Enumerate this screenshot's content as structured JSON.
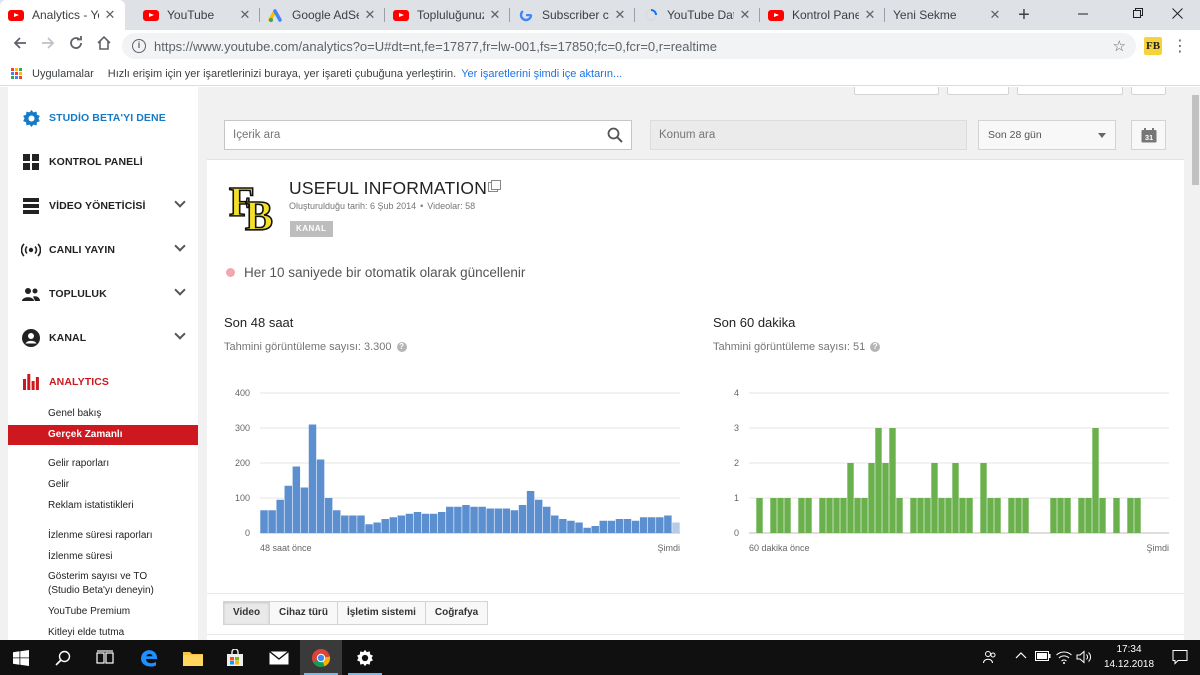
{
  "browser": {
    "tabs": [
      {
        "title": "Analytics - You",
        "favicon": "youtube-icon",
        "active": true
      },
      {
        "title": "YouTube",
        "favicon": "youtube-icon",
        "active": false
      },
      {
        "title": "Google AdSens",
        "favicon": "adsense-icon",
        "active": false
      },
      {
        "title": "Topluluğunuzu",
        "favicon": "youtube-icon",
        "active": false
      },
      {
        "title": "Subscriber cou",
        "favicon": "google-icon",
        "active": false
      },
      {
        "title": "YouTube Data",
        "favicon": "loading-icon",
        "active": false
      },
      {
        "title": "Kontrol Paneli",
        "favicon": "youtube-icon",
        "active": false
      },
      {
        "title": "Yeni Sekme",
        "favicon": "none",
        "active": false
      }
    ],
    "new_tab_symbol": "+",
    "url": "https://www.youtube.com/analytics?o=U#dt=nt,fe=17877,fr=lw-001,fs=17850;fc=0,fcr=0,r=realtime",
    "extension_label": "FB"
  },
  "bookmarks": {
    "apps_label": "Uygulamalar",
    "hint": "Hızlı erişim için yer işaretlerinizi buraya, yer işareti çubuğuna yerleştirin.",
    "import_link": "Yer işaretlerini şimdi içe aktarın..."
  },
  "sidebar": {
    "items": [
      {
        "label": "STUDİO BETA'YI DENE",
        "icon": "gear-icon"
      },
      {
        "label": "KONTROL PANELİ",
        "icon": "dashboard-icon"
      },
      {
        "label": "VİDEO YÖNETİCİSİ",
        "icon": "video-manager-icon"
      },
      {
        "label": "CANLI YAYIN",
        "icon": "live-broadcast-icon"
      },
      {
        "label": "TOPLULUK",
        "icon": "community-icon"
      },
      {
        "label": "KANAL",
        "icon": "channel-icon"
      },
      {
        "label": "ANALYTICS",
        "icon": "analytics-icon"
      }
    ],
    "sub_items": [
      {
        "label": "Genel bakış"
      },
      {
        "label": "Gerçek Zamanlı"
      },
      {
        "label": "Gelir raporları"
      },
      {
        "label": "Gelir"
      },
      {
        "label": "Reklam istatistikleri"
      },
      {
        "label": "İzlenme süresi raporları"
      },
      {
        "label": "İzlenme süresi"
      },
      {
        "label": "Gösterim sayısı ve TO"
      },
      {
        "label": "(Studio Beta'yı deneyin)"
      },
      {
        "label": "YouTube Premium"
      },
      {
        "label": "Kitleyi elde tutma"
      }
    ]
  },
  "filters": {
    "search_placeholder": "İçerik ara",
    "location_placeholder": "Konum ara",
    "date_range": "Son 28 gün",
    "calendar_day": "31"
  },
  "channel": {
    "logo_text": "FB",
    "name": "USEFUL INFORMATION",
    "created": "Oluşturulduğu tarih: 6 Şub 2014",
    "meta_separator": "•",
    "videos": "Videolar: 58",
    "badge": "KANAL"
  },
  "realtime_note": "Her 10 saniyede bir otomatik olarak güncellenir",
  "chart_data": [
    {
      "type": "bar",
      "title": "Son 48 saat",
      "subtitle": "Tahmini görüntüleme sayısı: 3.300",
      "xlabel_start": "48 saat önce",
      "xlabel_end": "Şimdi",
      "ylim": [
        0,
        400
      ],
      "yticks": [
        0,
        100,
        200,
        300,
        400
      ],
      "color": "#5b8fcf",
      "partial_color": "#b5cce9",
      "values": [
        65,
        65,
        95,
        135,
        190,
        130,
        310,
        210,
        100,
        65,
        50,
        50,
        50,
        25,
        30,
        40,
        45,
        50,
        55,
        60,
        55,
        55,
        60,
        75,
        75,
        80,
        75,
        75,
        70,
        70,
        70,
        65,
        80,
        120,
        95,
        75,
        50,
        40,
        35,
        30,
        15,
        20,
        35,
        35,
        40,
        40,
        35,
        45,
        45,
        45,
        50,
        30
      ]
    },
    {
      "type": "bar",
      "title": "Son 60 dakika",
      "subtitle": "Tahmini görüntüleme sayısı: 51",
      "xlabel_start": "60 dakika önce",
      "xlabel_end": "Şimdi",
      "ylim": [
        0,
        4
      ],
      "yticks": [
        0,
        1,
        2,
        3,
        4
      ],
      "color": "#6ab04c",
      "values": [
        0,
        1,
        0,
        1,
        1,
        1,
        0,
        1,
        1,
        0,
        1,
        1,
        1,
        1,
        2,
        1,
        1,
        2,
        3,
        2,
        3,
        1,
        0,
        1,
        1,
        1,
        2,
        1,
        1,
        2,
        1,
        1,
        0,
        2,
        1,
        1,
        0,
        1,
        1,
        1,
        0,
        0,
        0,
        1,
        1,
        1,
        0,
        1,
        1,
        3,
        1,
        0,
        1,
        0,
        1,
        1,
        0,
        0,
        0,
        0
      ]
    }
  ],
  "tabs_bottom": [
    {
      "label": "Video",
      "active": true
    },
    {
      "label": "Cihaz türü",
      "active": false
    },
    {
      "label": "İşletim sistemi",
      "active": false
    },
    {
      "label": "Coğrafya",
      "active": false
    }
  ],
  "taskbar": {
    "time": "17:34",
    "date": "14.12.2018"
  }
}
